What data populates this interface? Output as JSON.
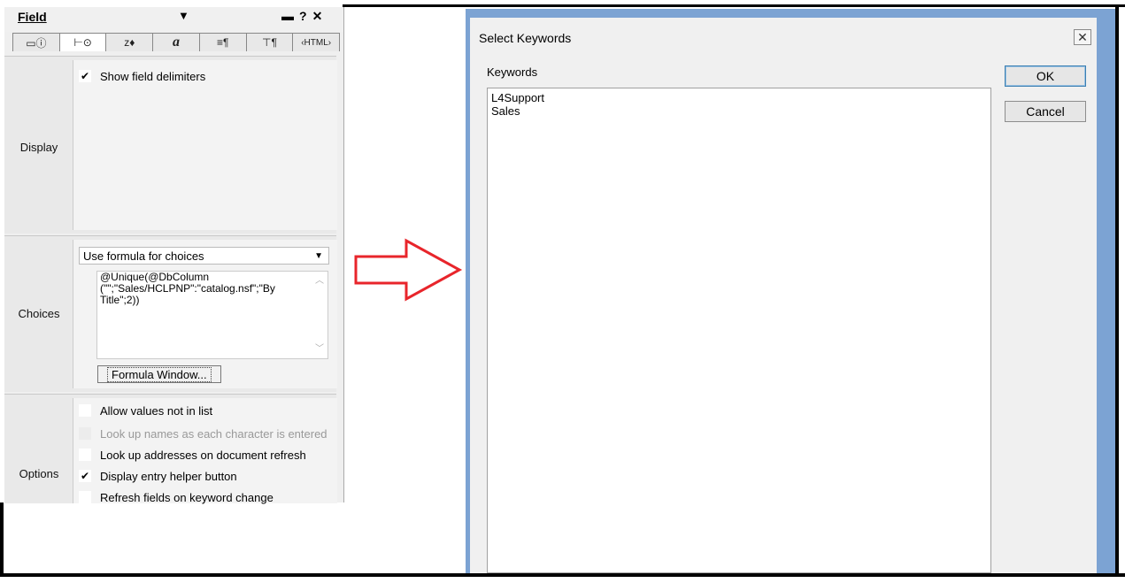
{
  "field_panel": {
    "title": "Field",
    "tabs": [
      "▭ⓘ",
      "⊢⊙",
      "ᴢ♦",
      "a",
      "≡¶",
      "⊤¶",
      "‹HTML›"
    ],
    "display": {
      "label": "Display",
      "show_delimiters": {
        "label": "Show field delimiters",
        "checked": "✔"
      }
    },
    "choices": {
      "label": "Choices",
      "select_value": "Use formula for choices",
      "formula_lines": [
        "@Unique(@DbColumn",
        "(\"\";\"Sales/HCLPNP\":\"catalog.nsf\";\"By",
        "Title\";2))"
      ],
      "formula_button": "Formula Window..."
    },
    "options": {
      "label": "Options",
      "items": [
        {
          "label": "Allow values not in list",
          "checked": "",
          "disabled": false
        },
        {
          "label": "Look up names as each character is entered",
          "checked": "",
          "disabled": true
        },
        {
          "label": "Look up addresses on document refresh",
          "checked": "",
          "disabled": false
        },
        {
          "label": "Display entry helper button",
          "checked": "✔",
          "disabled": false
        },
        {
          "label": "Refresh fields on keyword change",
          "checked": "",
          "disabled": false
        }
      ]
    }
  },
  "dialog": {
    "title": "Select Keywords",
    "keywords_label": "Keywords",
    "keywords": [
      "L4Support",
      "Sales"
    ],
    "ok_label": "OK",
    "cancel_label": "Cancel",
    "close_glyph": "✕"
  },
  "colors": {
    "arrow": "#e8252b",
    "dialog_frame": "#7ca3d3"
  }
}
